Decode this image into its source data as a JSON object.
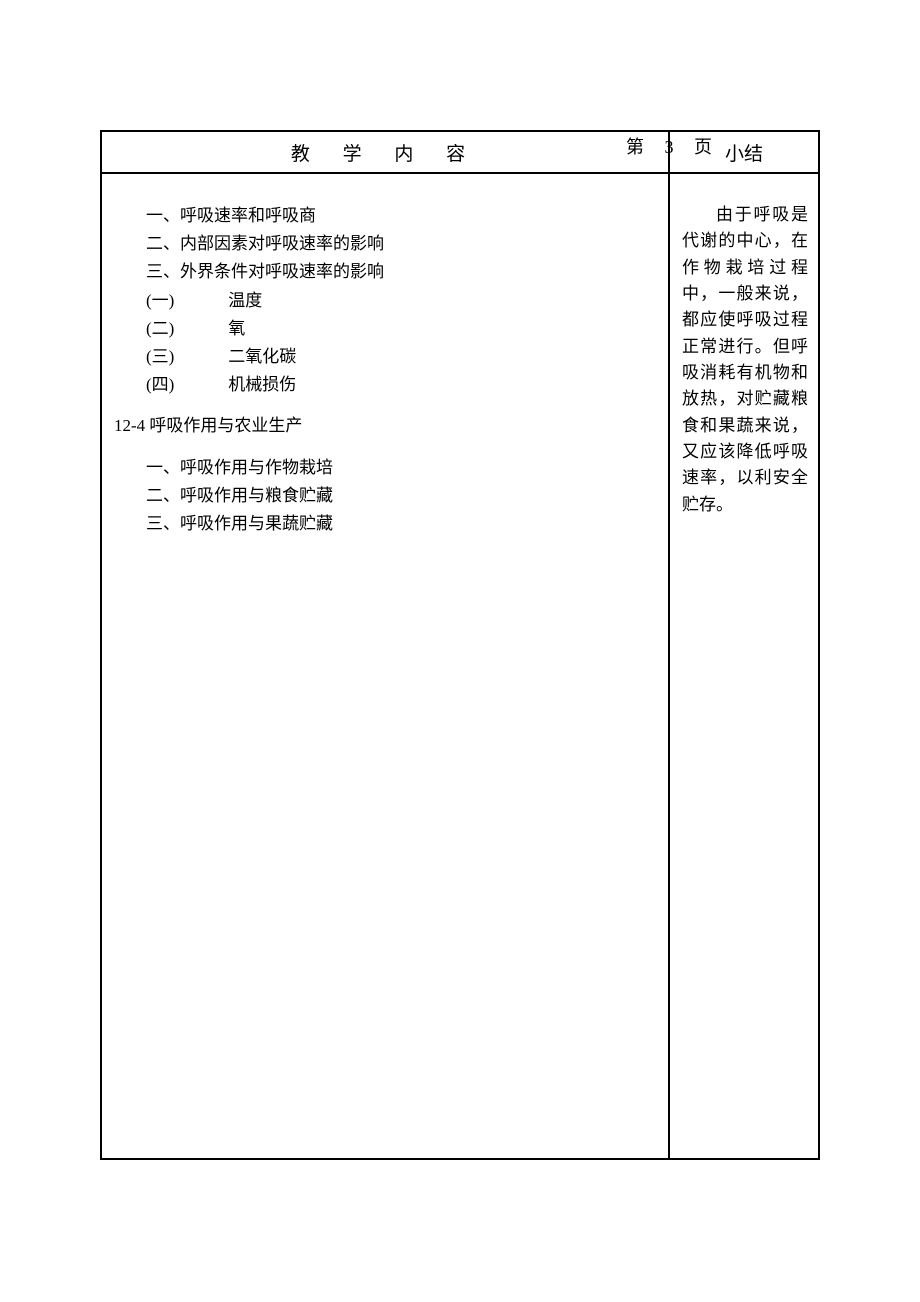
{
  "page_label": "第 3 页",
  "headers": {
    "left": "教 学 内 容",
    "right": "小结"
  },
  "outline": {
    "items_top": [
      "一、呼吸速率和呼吸商",
      "二、内部因素对呼吸速率的影响",
      "三、外界条件对呼吸速率的影响"
    ],
    "sub_items": [
      {
        "num": "(一)",
        "text": "温度"
      },
      {
        "num": "(二)",
        "text": "氧"
      },
      {
        "num": "(三)",
        "text": "二氧化碳"
      },
      {
        "num": "(四)",
        "text": "机械损伤"
      }
    ],
    "section_heading": "12-4 呼吸作用与农业生产",
    "items_bottom": [
      "一、呼吸作用与作物栽培",
      "二、呼吸作用与粮食贮藏",
      "三、呼吸作用与果蔬贮藏"
    ]
  },
  "summary": "由于呼吸是代谢的中心，在作物栽培过程中，一般来说，都应使呼吸过程正常进行。但呼吸消耗有机物和放热，对贮藏粮食和果蔬来说，又应该降低呼吸速率，以利安全贮存。"
}
